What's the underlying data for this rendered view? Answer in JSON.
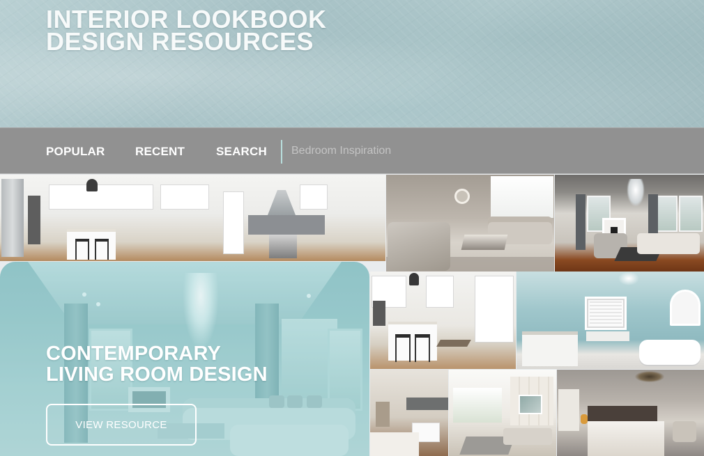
{
  "header": {
    "title_line1": "INTERIOR LOOKBOOK",
    "title_line2": "DESIGN RESOURCES"
  },
  "nav": {
    "items": [
      {
        "label": "POPULAR"
      },
      {
        "label": "RECENT"
      },
      {
        "label": "SEARCH"
      }
    ],
    "search_placeholder": "Bedroom Inspiration",
    "divider_color": "#b9dedd"
  },
  "featured": {
    "title_line1": "CONTEMPORARY",
    "title_line2": "LIVING ROOM DESIGN",
    "button_label": "VIEW RESOURCE",
    "accent_color": "#9fcacc"
  },
  "gallery": {
    "tiles": [
      {
        "subject": "white kitchen with island"
      },
      {
        "subject": "grey living room"
      },
      {
        "subject": "living room with fireplace and wood floor"
      },
      {
        "subject": "white kitchen with stools"
      },
      {
        "subject": "light blue bathroom with tub"
      },
      {
        "subject": "modern bedroom"
      },
      {
        "subject": "neutral living room with panel wall"
      },
      {
        "subject": "attic bedroom"
      }
    ]
  },
  "colors": {
    "header_bg": "#b3cbce",
    "nav_bg": "#919191",
    "text_light": "#ffffff"
  }
}
